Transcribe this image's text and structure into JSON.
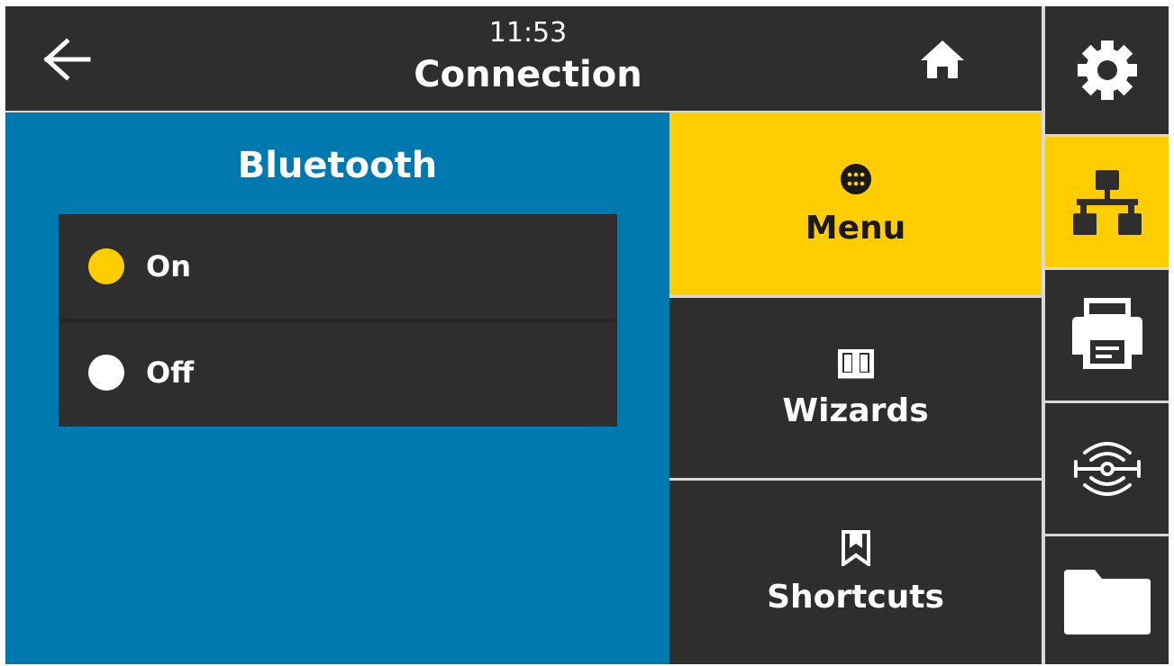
{
  "header": {
    "time": "11:53",
    "title": "Connection",
    "back_icon": "arrow-left-icon",
    "home_icon": "home-icon"
  },
  "panel": {
    "title": "Bluetooth",
    "options": [
      {
        "label": "On",
        "selected": true
      },
      {
        "label": "Off",
        "selected": false
      }
    ]
  },
  "nav": {
    "menu": {
      "label": "Menu",
      "icon": "menu-grid-icon",
      "active": true
    },
    "wizards": {
      "label": "Wizards",
      "icon": "book-icon"
    },
    "shortcuts": {
      "label": "Shortcuts",
      "icon": "bookmark-icon"
    }
  },
  "tabs": [
    {
      "icon": "gear-icon"
    },
    {
      "icon": "network-icon",
      "active": true
    },
    {
      "icon": "printer-icon"
    },
    {
      "icon": "rfid-icon"
    },
    {
      "icon": "folder-icon"
    }
  ],
  "colors": {
    "accent": "#ffcd00",
    "panel_blue": "#0079b0",
    "dark": "#2e2e2e"
  }
}
